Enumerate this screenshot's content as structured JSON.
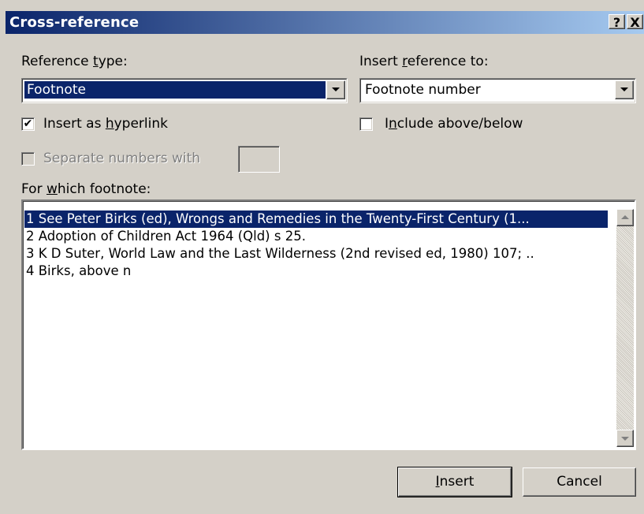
{
  "window": {
    "title": "Cross-reference",
    "help_label": "?",
    "close_label": "X"
  },
  "reference_type": {
    "label_pre": "Reference ",
    "label_accel": "t",
    "label_post": "ype:",
    "value": "Footnote"
  },
  "insert_reference": {
    "label_pre": "Insert ",
    "label_accel": "r",
    "label_post": "eference to:",
    "value": "Footnote number"
  },
  "insert_hyperlink": {
    "checked": true,
    "check_glyph": "✔",
    "label_pre": "Insert as ",
    "label_accel": "h",
    "label_post": "yperlink"
  },
  "include_above_below": {
    "checked": false,
    "label_pre": "I",
    "label_accel": "n",
    "label_post": "clude above/below"
  },
  "separate_numbers": {
    "checked": false,
    "enabled": false,
    "label": "Separate numbers with",
    "value": ""
  },
  "which_footnote": {
    "label_pre": "For ",
    "label_accel": "w",
    "label_post": "hich footnote:",
    "items": [
      "1  See Peter Birks (ed), Wrongs and Remedies in the Twenty-First Century (1...",
      "2  Adoption of Children Act 1964 (Qld) s 25.",
      "3  K D Suter, World Law and the Last Wilderness (2nd revised ed, 1980) 107; ..",
      "4  Birks, above n"
    ],
    "selected_index": 0
  },
  "buttons": {
    "insert_accel": "I",
    "insert_rest": "nsert",
    "cancel": "Cancel"
  },
  "colors": {
    "titlebar_start": "#0a246a",
    "titlebar_end": "#a6caf0",
    "selection": "#0a246a",
    "face": "#d4d0c8"
  }
}
